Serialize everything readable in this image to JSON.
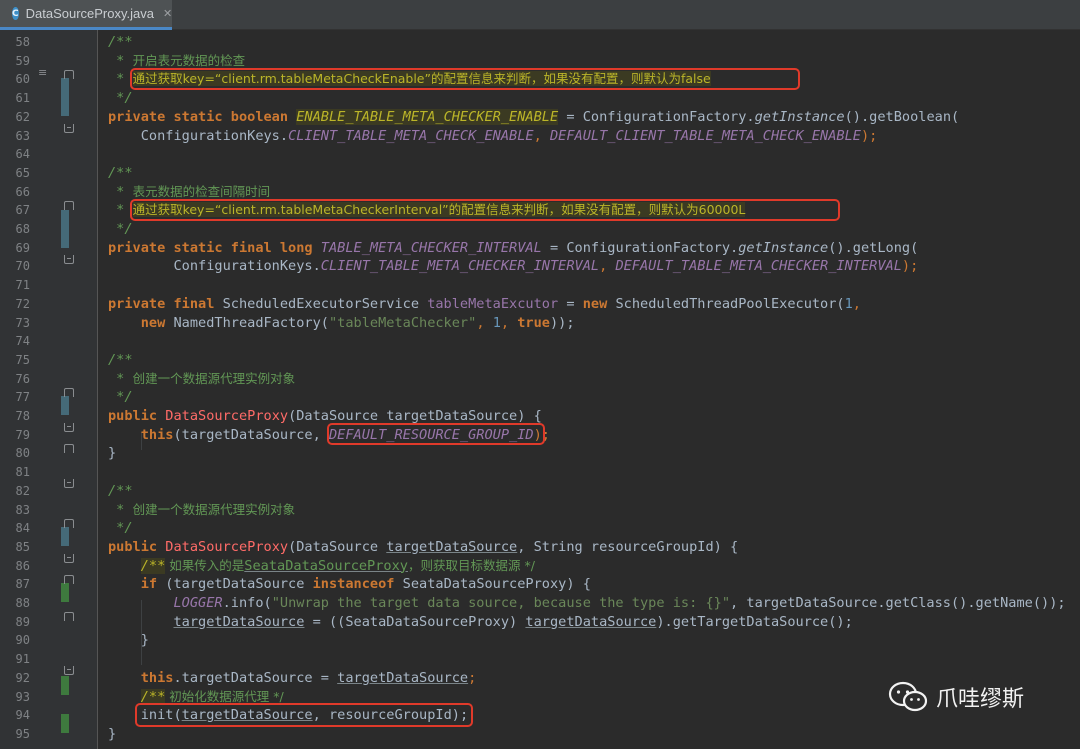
{
  "tab": {
    "title": "DataSourceProxy.java",
    "icon": "C"
  },
  "gutter": {
    "numbers": [
      "58",
      "59",
      "60",
      "61",
      "62",
      "63",
      "64",
      "65",
      "66",
      "67",
      "68",
      "69",
      "70",
      "71",
      "72",
      "73",
      "74",
      "75",
      "76",
      "77",
      "78",
      "79",
      "80",
      "81",
      "82",
      "83",
      "84",
      "85",
      "86",
      "87",
      "88",
      "89",
      "90",
      "91",
      "92",
      "93",
      "94",
      "95"
    ]
  },
  "code": {
    "l58": "/**",
    "l59a": " * ",
    "l59b": "开启表元数据的检查",
    "l60a": " * ",
    "l60b": "通过获取key=“client.rm.tableMetaCheckEnable”的配置信息来判断，如果没有配置，则默认为false",
    "l61": " */",
    "l62a": "private static boolean ",
    "l62b": "ENABLE_TABLE_META_CHECKER_ENABLE",
    "l62c": " = ConfigurationFactory.",
    "l62d": "getInstance",
    "l62e": "().getBoolean(",
    "l63a": "    ConfigurationKeys.",
    "l63b": "CLIENT_TABLE_META_CHECK_ENABLE",
    "l63c": ", ",
    "l63d": "DEFAULT_CLIENT_TABLE_META_CHECK_ENABLE",
    "l63e": ");",
    "l65": "/**",
    "l66a": " * ",
    "l66b": "表元数据的检查间隔时间",
    "l67a": " * ",
    "l67b": "通过获取key=“client.rm.tableMetaCheckerInterval”的配置信息来判断，如果没有配置，则默认为60000L",
    "l68": " */",
    "l69a": "private static final long ",
    "l69b": "TABLE_META_CHECKER_INTERVAL",
    "l69c": " = ConfigurationFactory.",
    "l69d": "getInstance",
    "l69e": "().getLong(",
    "l70a": "        ConfigurationKeys.",
    "l70b": "CLIENT_TABLE_META_CHECKER_INTERVAL",
    "l70c": ", ",
    "l70d": "DEFAULT_TABLE_META_CHECKER_INTERVAL",
    "l70e": ");",
    "l72a": "private final ",
    "l72b": "ScheduledExecutorService ",
    "l72c": "tableMetaExcutor",
    "l72d": " = ",
    "l72e": "new ",
    "l72f": "ScheduledThreadPoolExecutor(",
    "l72g": "1",
    "l72h": ",",
    "l73a": "    new ",
    "l73b": "NamedThreadFactory(",
    "l73c": "\"tableMetaChecker\"",
    "l73d": ", ",
    "l73e": "1",
    "l73f": ", ",
    "l73g": "true",
    "l73h": "));",
    "l75": "/**",
    "l76a": " * ",
    "l76b": "创建一个数据源代理实例对象",
    "l77": " */",
    "l78a": "public ",
    "l78b": "DataSourceProxy",
    "l78c": "(DataSource targetDataSource) {",
    "l79a": "    this",
    "l79b": "(targetDataSource, ",
    "l79c": "DEFAULT_RESOURCE_GROUP_ID",
    "l79d": ");",
    "l80": "}",
    "l82": "/**",
    "l83a": " * ",
    "l83b": "创建一个数据源代理实例对象",
    "l84": " */",
    "l85a": "public ",
    "l85b": "DataSourceProxy",
    "l85c": "(DataSource ",
    "l85d": "targetDataSource",
    "l85e": ", String resourceGroupId) {",
    "l86a": "    ",
    "l86b": "/**",
    "l86c": " 如果传入的是",
    "l86d": "SeataDataSourceProxy",
    "l86e": "，则获取目标数据源 */",
    "l87a": "    if ",
    "l87b": "(targetDataSource ",
    "l87c": "instanceof ",
    "l87d": "SeataDataSourceProxy) {",
    "l88a": "        ",
    "l88b": "LOGGER",
    "l88c": ".info(",
    "l88d": "\"Unwrap the target data source, because the type is: {}\"",
    "l88e": ", targetDataSource.getClass().getName());",
    "l89a": "        ",
    "l89b": "targetDataSource",
    "l89c": " = ((SeataDataSourceProxy) ",
    "l89d": "targetDataSource",
    "l89e": ").getTargetDataSource();",
    "l90": "    }",
    "l92a": "    this",
    "l92b": ".targetDataSource = ",
    "l92c": "targetDataSource",
    "l92d": ";",
    "l93a": "    ",
    "l93b": "/**",
    "l93c": " 初始化数据源代理 */",
    "l94a": "    init(",
    "l94b": "targetDataSource",
    "l94c": ", resourceGroupId);",
    "l95": "}"
  },
  "watermark": {
    "text": "爪哇缪斯",
    "icon": "wechat-icon"
  },
  "colors": {
    "background": "#2b2b2b",
    "gutter": "#313335",
    "keyword": "#cc7832",
    "comment": "#629755",
    "constant": "#9876aa",
    "highlight_box": "#e03a2a"
  }
}
